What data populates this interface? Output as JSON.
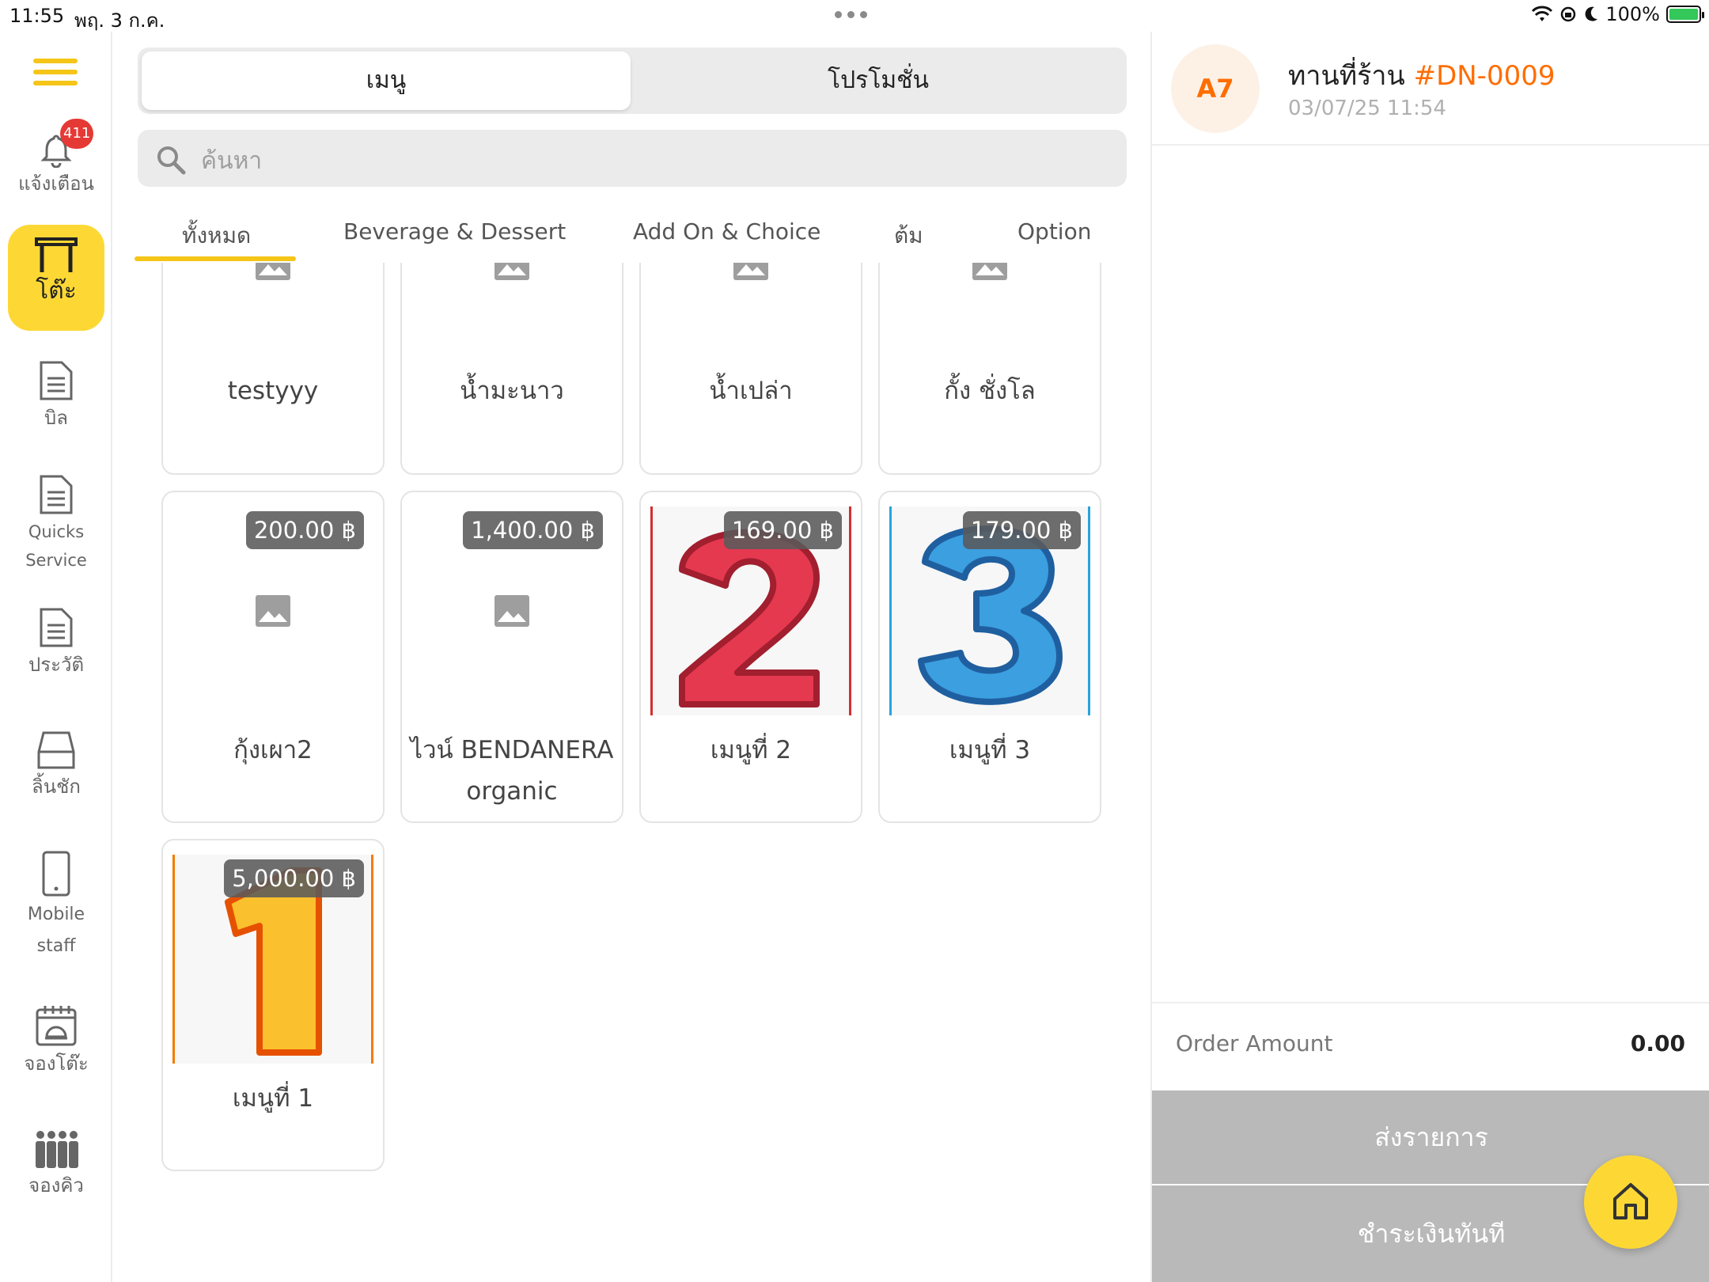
{
  "status_bar": {
    "time": "11:55",
    "date": "พฤ. 3 ก.ค.",
    "battery": "100%"
  },
  "sidebar": {
    "notification_badge": "411",
    "items": [
      {
        "label": "แจ้งเตือน",
        "icon": "bell-icon"
      },
      {
        "label": "โต๊ะ",
        "icon": "table-icon",
        "active": true
      },
      {
        "label": "บิล",
        "icon": "document-icon"
      },
      {
        "label": "Quicks Service",
        "icon": "document-icon"
      },
      {
        "label": "ประวัติ",
        "icon": "document-icon"
      },
      {
        "label": "ลิ้นชัก",
        "icon": "drawer-icon"
      },
      {
        "label": "Mobile staff",
        "icon": "mobile-icon"
      },
      {
        "label": "จองโต๊ะ",
        "icon": "calendar-icon"
      },
      {
        "label": "จองคิว",
        "icon": "queue-people-icon"
      }
    ]
  },
  "segment": {
    "menu": "เมนู",
    "promotion": "โปรโมชั่น",
    "selected": "เมนู"
  },
  "search": {
    "placeholder": "ค้นหา"
  },
  "categories": [
    "ทั้งหมด",
    "Beverage & Dessert",
    "Add On & Choice",
    "ต้ม",
    "Option"
  ],
  "selected_category": "ทั้งหมด",
  "menu_items": [
    {
      "name": "testyyy",
      "price": ""
    },
    {
      "name": "น้ำมะนาว",
      "price": ""
    },
    {
      "name": "น้ำเปล่า",
      "price": ""
    },
    {
      "name": "กั้ง ชั่งโล",
      "price": ""
    },
    {
      "name": "กุ้งเผา2",
      "price": "200.00 ฿"
    },
    {
      "name": "ไวน์ BENDANERA organic",
      "price": "1,400.00 ฿"
    },
    {
      "name": "เมนูที่ 2",
      "price": "169.00 ฿",
      "image": "number-2"
    },
    {
      "name": "เมนูที่ 3",
      "price": "179.00 ฿",
      "image": "number-3"
    },
    {
      "name": "เมนูที่ 1",
      "price": "5,000.00 ฿",
      "image": "number-1"
    }
  ],
  "order": {
    "table": "A7",
    "title": "ทานที่ร้าน",
    "number": "#DN-0009",
    "datetime": "03/07/25 11:54",
    "amount_label": "Order Amount",
    "amount": "0.00",
    "send_button": "ส่งรายการ",
    "pay_button": "ชำระเงินทันที"
  },
  "colors": {
    "accent": "#fdd835",
    "order_number": "#ff6d00",
    "badge": "#e53935"
  }
}
